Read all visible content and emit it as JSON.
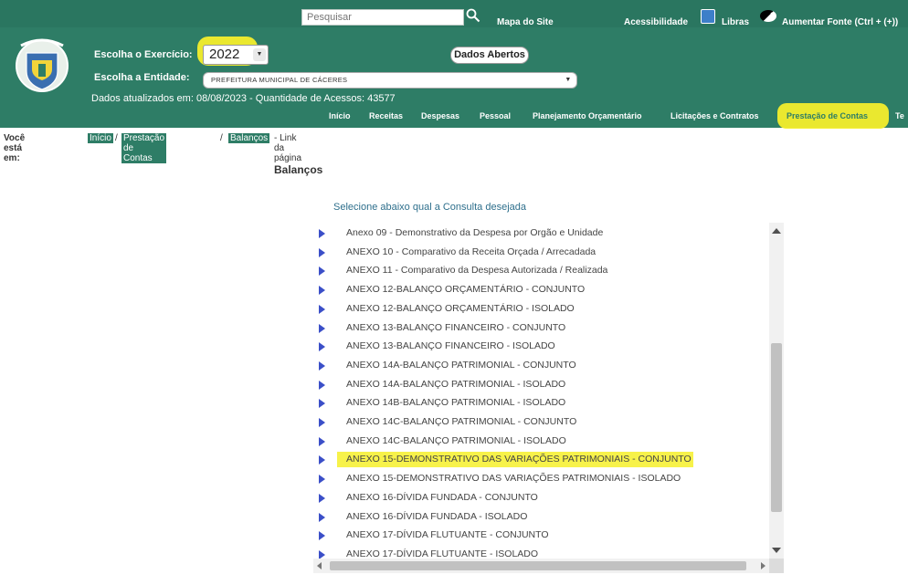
{
  "topbar": {
    "search_placeholder": "Pesquisar",
    "site_map": "Mapa do Site",
    "accessibility": "Acessibilidade",
    "libras": "Libras",
    "font_size": "Aumentar Fonte (Ctrl + (+))"
  },
  "filters": {
    "year_label": "Escolha o Exercício:",
    "year_value": "2022",
    "entity_label": "Escolha a Entidade:",
    "entity_value": "PREFEITURA MUNICIPAL DE CÁCERES",
    "open_data_button": "Dados Abertos",
    "status": "Dados atualizados em: 08/08/2023 - Quantidade de Acessos: 43577"
  },
  "nav": {
    "items": [
      {
        "label": "Início"
      },
      {
        "label": "Receitas"
      },
      {
        "label": "Despesas"
      },
      {
        "label": "Pessoal"
      },
      {
        "label": "Planejamento Orçamentário"
      },
      {
        "label": "Licitações e Contratos"
      },
      {
        "label": "Prestação de Contas"
      },
      {
        "label": "Te"
      }
    ],
    "active_index": 6
  },
  "breadcrumb": {
    "prefix": "Você está em:",
    "home": "Início",
    "sep1": "/",
    "parent": "Prestação de Contas",
    "sep2": "/",
    "current": "Balanços",
    "suffix": "- Link da página"
  },
  "content": {
    "title": "Balanços",
    "prompt": "Selecione abaixo qual a Consulta desejada",
    "items": [
      {
        "label": "Anexo 09 - Demonstrativo da Despesa por Orgão e Unidade"
      },
      {
        "label": "ANEXO 10 - Comparativo da Receita Orçada / Arrecadada"
      },
      {
        "label": "ANEXO 11 - Comparativo da Despesa Autorizada / Realizada"
      },
      {
        "label": "ANEXO 12-BALANÇO ORÇAMENTÁRIO - CONJUNTO"
      },
      {
        "label": "ANEXO 12-BALANÇO ORÇAMENTÁRIO - ISOLADO"
      },
      {
        "label": "ANEXO 13-BALANÇO FINANCEIRO - CONJUNTO"
      },
      {
        "label": "ANEXO 13-BALANÇO FINANCEIRO - ISOLADO"
      },
      {
        "label": "ANEXO 14A-BALANÇO PATRIMONIAL - CONJUNTO"
      },
      {
        "label": "ANEXO 14A-BALANÇO PATRIMONIAL - ISOLADO"
      },
      {
        "label": "ANEXO 14B-BALANÇO PATRIMONIAL - ISOLADO"
      },
      {
        "label": "ANEXO 14C-BALANÇO PATRIMONIAL - CONJUNTO"
      },
      {
        "label": "ANEXO 14C-BALANÇO PATRIMONIAL - ISOLADO"
      },
      {
        "label": "ANEXO 15-DEMONSTRATIVO DAS VARIAÇÕES PATRIMONIAIS - CONJUNTO"
      },
      {
        "label": "ANEXO 15-DEMONSTRATIVO DAS VARIAÇÕES PATRIMONIAIS - ISOLADO"
      },
      {
        "label": "ANEXO 16-DÍVIDA FUNDADA - CONJUNTO"
      },
      {
        "label": "ANEXO 16-DÍVIDA FUNDADA - ISOLADO"
      },
      {
        "label": "ANEXO 17-DÍVIDA FLUTUANTE - CONJUNTO"
      },
      {
        "label": "ANEXO 17-DÍVIDA FLUTUANTE - ISOLADO"
      }
    ],
    "highlighted_index": 12
  },
  "colors": {
    "brand_green": "#2e7d66",
    "highlight_yellow": "#f4ee2c",
    "bullet_blue": "#3b4fc8"
  }
}
